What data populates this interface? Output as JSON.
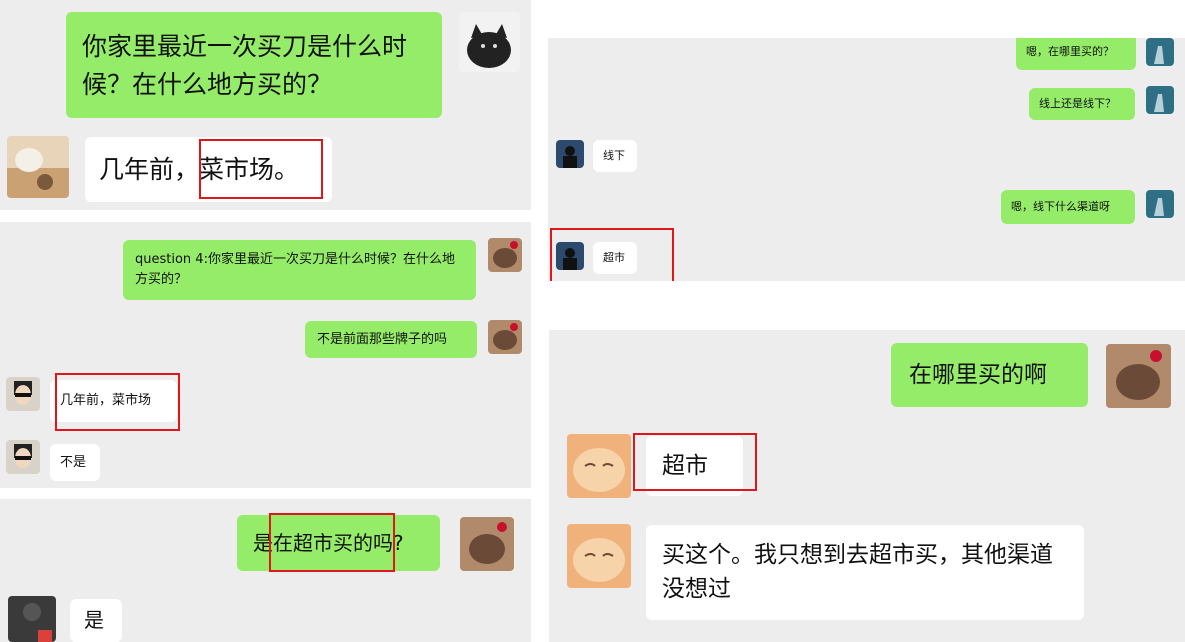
{
  "colors": {
    "green_bubble": "#95ec69",
    "white_bubble": "#ffffff",
    "chat_background": "#ededed",
    "highlight": "#e0161d"
  },
  "panel_a": {
    "question": "你家里最近一次买刀是什么时候？在什么地方买的？",
    "answer": "几年前，菜市场。"
  },
  "panel_b": {
    "question": "question 4:你家里最近一次买刀是什么时候？在什么地方买的？",
    "followup": "不是前面那些牌子的吗",
    "answer1": "几年前，菜市场",
    "answer2": "不是"
  },
  "panel_c": {
    "question": "是在超市买的吗?",
    "answer": "是"
  },
  "panel_d": {
    "q1": "嗯，在哪里买的？",
    "q2": "线上还是线下？",
    "a1": "线下",
    "q3": "嗯，线下什么渠道呀",
    "a2": "超市"
  },
  "panel_e": {
    "question": "在哪里买的啊",
    "answer1": "超市",
    "answer2": "买这个。我只想到去超市买，其他渠道没想过"
  }
}
